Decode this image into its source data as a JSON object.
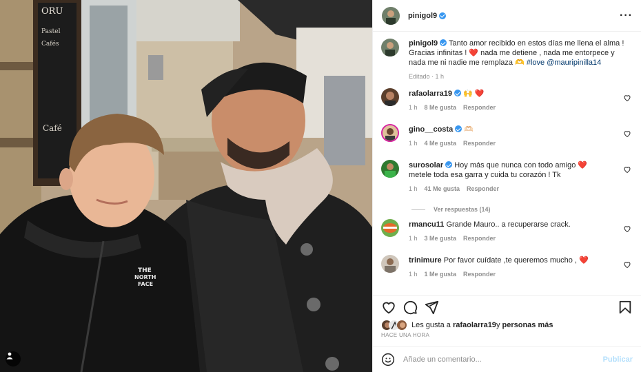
{
  "post": {
    "author": "pinigol9",
    "more_icon": "more-horizontal-icon",
    "caption": {
      "username": "pinigol9",
      "text_1": " Tanto amor recibido en estos días me llena el alma ! Gracias infinitas ! ",
      "emoji_1": "❤️",
      "text_2": " nada me detiene , nada me entorpece y nada me ni nadie me remplaza ",
      "emoji_2": "🫶",
      "hashtag": "#love",
      "mention": "@mauripinilla14",
      "edited": "Editado",
      "time": "1 h"
    },
    "comments": [
      {
        "username": "rafaolarra19",
        "verified": true,
        "text": "🙌 ❤️",
        "time": "1 h",
        "likes": "8 Me gusta",
        "reply": "Responder"
      },
      {
        "username": "gino__costa",
        "verified": true,
        "text": "🫶🏻",
        "time": "1 h",
        "likes": "4 Me gusta",
        "reply": "Responder"
      },
      {
        "username": "surosolar",
        "verified": true,
        "text": "Hoy más que nunca con todo amigo ❤️ metele toda esa garra y cuida tu corazón ! Tk",
        "time": "1 h",
        "likes": "41 Me gusta",
        "reply": "Responder"
      },
      {
        "username": "rmancu11",
        "verified": false,
        "text": "Grande Mauro.. a recuperarse crack.",
        "time": "1 h",
        "likes": "3 Me gusta",
        "reply": "Responder"
      },
      {
        "username": "trinimure",
        "verified": false,
        "text": "Por favor cuídate ,te queremos mucho , ❤️",
        "time": "1 h",
        "likes": "1 Me gusta",
        "reply": "Responder"
      }
    ],
    "view_replies": "Ver respuestas (14)",
    "liked_by": {
      "prefix": "Les gusta a ",
      "user": "rafaolarra19",
      "middle": " y ",
      "others": "personas más"
    },
    "timestamp": "HACE UNA HORA",
    "add_comment_placeholder": "Añade un comentario...",
    "publish_label": "Publicar",
    "photo_alt_icon": "user-tag-icon",
    "colors": {
      "verified": "#3897f0",
      "heart": "#ed4956",
      "link": "#00376b",
      "publish": "#b2dffc"
    }
  }
}
